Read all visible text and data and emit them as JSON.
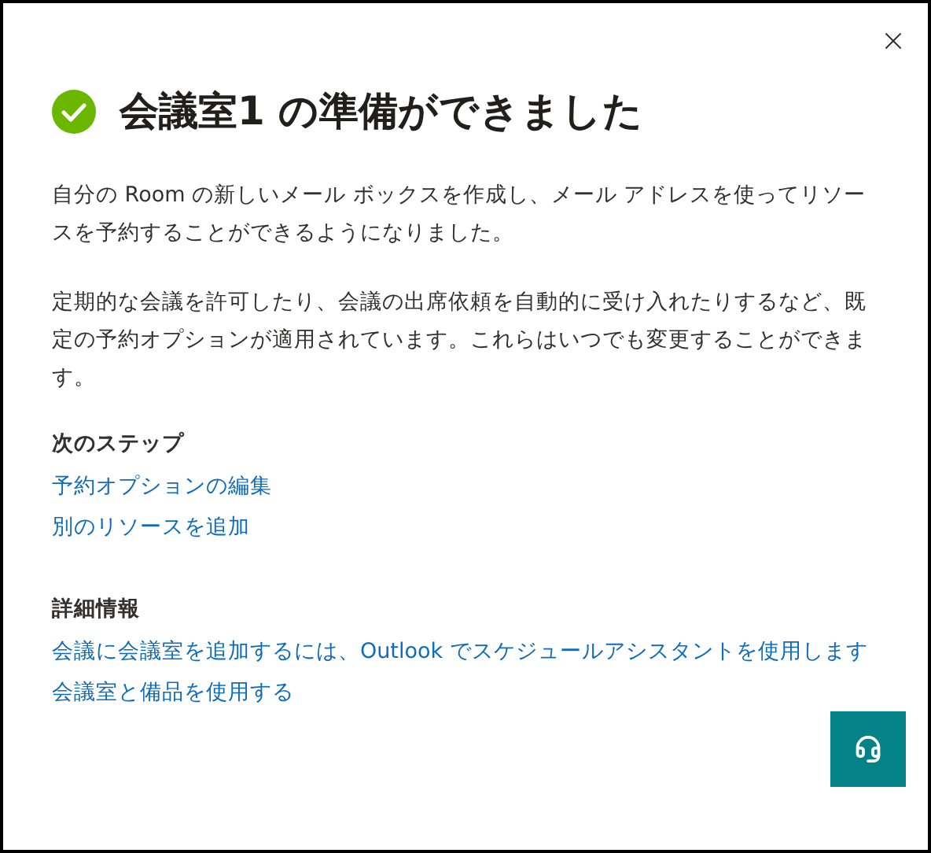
{
  "dialog": {
    "title": "会議室1 の準備ができました",
    "paragraphs": [
      "自分の Room の新しいメール ボックスを作成し、メール アドレスを使ってリソースを予約することができるようになりました。",
      "定期的な会議を許可したり、会議の出席依頼を自動的に受け入れたりするなど、既定の予約オプションが適用されています。これらはいつでも変更することができます。"
    ],
    "sections": [
      {
        "heading": "次のステップ",
        "links": [
          "予約オプションの編集",
          "別のリソースを追加"
        ]
      },
      {
        "heading": "詳細情報",
        "links": [
          "会議に会議室を追加するには、Outlook でスケジュールアシスタントを使用します",
          "会議室と備品を使用する"
        ]
      }
    ]
  }
}
